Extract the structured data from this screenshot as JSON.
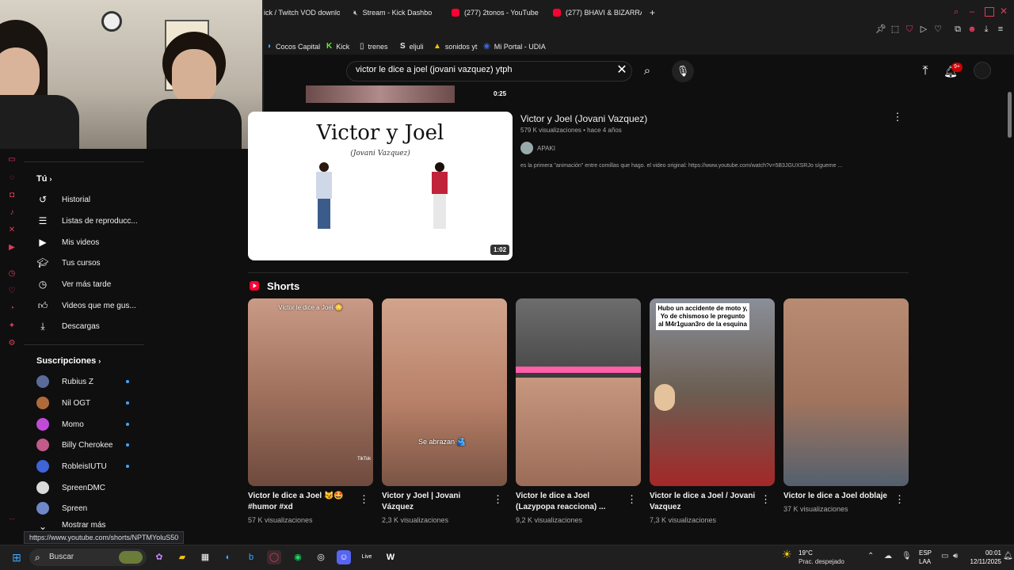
{
  "browser": {
    "tabs": [
      {
        "label": "ick / Twitch VOD downlo",
        "icon": "download-icon"
      },
      {
        "label": "Stream - Kick Dashbo",
        "icon": "kick-icon"
      },
      {
        "label": "(277) 2tonos - YouTube",
        "icon": "youtube-icon"
      },
      {
        "label": "(277) BHAVI & BIZARRAP",
        "icon": "youtube-icon"
      }
    ],
    "new_tab": "+",
    "bookmarks": [
      {
        "label": "Cocos Capital",
        "icon": "cocos-icon"
      },
      {
        "label": "Kick",
        "icon": "kick-icon"
      },
      {
        "label": "trenes",
        "icon": "doc-icon"
      },
      {
        "label": "eljuli",
        "icon": "s-icon"
      },
      {
        "label": "sonidos yt",
        "icon": "triangle-icon"
      },
      {
        "label": "Mi Portal - UDIA",
        "icon": "udia-icon"
      }
    ]
  },
  "header": {
    "search_query": "victor le dice a joel (jovani vazquez) ytph",
    "notifications": "9+"
  },
  "sidebar": {
    "you_heading": "Tú",
    "items": [
      {
        "label": "Historial",
        "icon": "history-icon"
      },
      {
        "label": "Listas de reproducc...",
        "icon": "playlist-icon"
      },
      {
        "label": "Mis videos",
        "icon": "my-videos-icon"
      },
      {
        "label": "Tus cursos",
        "icon": "courses-icon"
      },
      {
        "label": "Ver más tarde",
        "icon": "clock-icon"
      },
      {
        "label": "Videos que me gus...",
        "icon": "like-icon"
      },
      {
        "label": "Descargas",
        "icon": "download-icon"
      }
    ],
    "subs_heading": "Suscripciones",
    "subscriptions": [
      {
        "name": "Rubius Z",
        "color": "#5a6b9a"
      },
      {
        "name": "Nil OGT",
        "color": "#b06a3a"
      },
      {
        "name": "Momo",
        "color": "#c04bd6"
      },
      {
        "name": "Billy Cherokee",
        "color": "#c25a8a"
      },
      {
        "name": "RobleisIUTU",
        "color": "#3e64d8"
      },
      {
        "name": "SpreenDMC",
        "color": "#d9d9d9"
      },
      {
        "name": "Spreen",
        "color": "#6f86c9"
      }
    ],
    "show_more": "Mostrar más"
  },
  "prev_result": {
    "duration": "0:25"
  },
  "result": {
    "thumb_title": "Victor y Joel",
    "thumb_subtitle": "(Jovani Vazquez)",
    "duration": "1:02",
    "title": "Victor y Joel (Jovani Vazquez)",
    "meta": "579 K visualizaciones • hace 4 años",
    "channel": "APAKI",
    "description": "es la primera \"animación\" entre comillas que hago. el video original: https://www.youtube.com/watch?v=5B3JGUXSRJo sígueme ..."
  },
  "shorts": {
    "heading": "Shorts",
    "items": [
      {
        "title": "Victor le dice a Joel 😼🤩 #humor #xd",
        "views": "57 K visualizaciones",
        "overlay": "Victor le dice a Joel 😳",
        "badge": "TikTok"
      },
      {
        "title": "Victor y Joel  | Jovani Vázquez",
        "views": "2,3 K visualizaciones",
        "overlay": "Se abrazan 🫂"
      },
      {
        "title": "Victor le dice a Joel (Lazypopa reacciona) ...",
        "views": "9,2 K visualizaciones",
        "overlay": ""
      },
      {
        "title": "Victor le dice a Joel / Jovani Vazquez",
        "views": "7,3 K visualizaciones",
        "overlay": "Hubo un accidente de moto y, Yo de chismoso le pregunto al M4r1guan3ro de la esquina"
      },
      {
        "title": "Victor le dice a Joel doblaje",
        "views": "37 K visualizaciones",
        "overlay": ""
      }
    ]
  },
  "status_url": "https://www.youtube.com/shorts/NPTMYoluS50",
  "taskbar": {
    "search_label": "Buscar",
    "weather_temp": "19°C",
    "weather_desc": "Prac. despejado",
    "lang_1": "ESP",
    "lang_2": "LAA",
    "time": "00:01",
    "date": "12/11/2025"
  }
}
